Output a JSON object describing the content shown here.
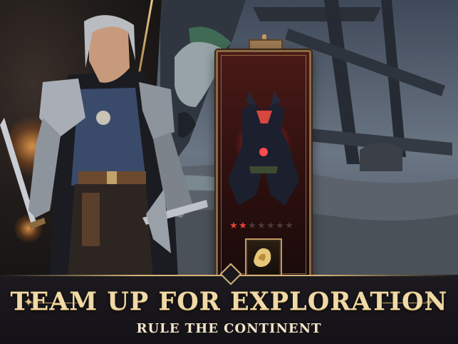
{
  "banner": {
    "title": "TEAM UP FOR EXPLORATION",
    "subtitle": "RULE THE CONTINENT"
  },
  "card": {
    "stars_filled": 2,
    "stars_total": 7,
    "star_glyph": "★"
  },
  "colors": {
    "gold": "#d6b478",
    "title_text": "#f0d9a6",
    "star_active": "#e2453a",
    "card_red": "#4a1a16"
  },
  "icons": {
    "ornament_left": "four-point-star-icon",
    "ornament_right": "four-point-star-icon"
  }
}
